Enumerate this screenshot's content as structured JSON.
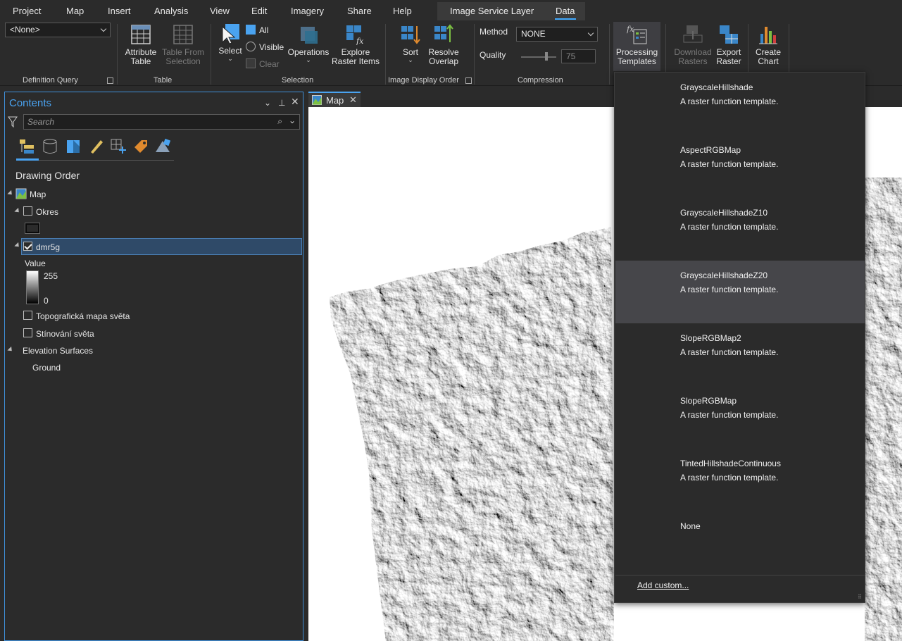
{
  "menubar": {
    "items": [
      "Project",
      "Map",
      "Insert",
      "Analysis",
      "View",
      "Edit",
      "Imagery",
      "Share",
      "Help"
    ],
    "contextual_tabs": [
      "Image Service Layer",
      "Data"
    ],
    "active_tab": "Data"
  },
  "ribbon": {
    "definition_query": {
      "value": "<None>",
      "group_label": "Definition Query"
    },
    "table": {
      "attribute_table": "Attribute\nTable",
      "table_from_selection": "Table From\nSelection",
      "group_label": "Table"
    },
    "selection": {
      "select": "Select",
      "all": "All",
      "visible": "Visible",
      "clear": "Clear",
      "operations": "Operations",
      "explore": "Explore\nRaster Items",
      "group_label": "Selection"
    },
    "image_display_order": {
      "sort": "Sort",
      "resolve_overlap": "Resolve\nOverlap",
      "group_label": "Image Display Order"
    },
    "compression": {
      "method_label": "Method",
      "method_value": "NONE",
      "quality_label": "Quality",
      "quality_value": "75",
      "group_label": "Compression"
    },
    "processing_templates": "Processing\nTemplates",
    "download_rasters": "Download\nRasters",
    "export_raster": "Export\nRaster",
    "create_chart": "Create\nChart"
  },
  "contents": {
    "title": "Contents",
    "search_placeholder": "Search",
    "section": "Drawing Order",
    "map": "Map",
    "layers": {
      "okres": "Okres",
      "dmr5g": "dmr5g",
      "legend_title": "Value",
      "legend_max": "255",
      "legend_min": "0",
      "topo": "Topografická mapa světa",
      "stinovani": "Stínování světa",
      "elevation": "Elevation Surfaces",
      "ground": "Ground"
    }
  },
  "map_tab": {
    "label": "Map"
  },
  "dropdown": {
    "items": [
      {
        "name": "GrayscaleHillshade",
        "desc": "A raster function template."
      },
      {
        "name": "AspectRGBMap",
        "desc": "A raster function template."
      },
      {
        "name": "GrayscaleHillshadeZ10",
        "desc": "A raster function template."
      },
      {
        "name": "GrayscaleHillshadeZ20",
        "desc": "A raster function template."
      },
      {
        "name": "SlopeRGBMap2",
        "desc": "A raster function template."
      },
      {
        "name": "SlopeRGBMap",
        "desc": "A raster function template."
      },
      {
        "name": "TintedHillshadeContinuous",
        "desc": "A raster function template."
      },
      {
        "name": "None",
        "desc": ""
      }
    ],
    "highlighted_index": 3,
    "add_custom": "Add custom..."
  },
  "colors": {
    "accent": "#4aa3f0",
    "background": "#2b2b2b",
    "highlight": "#46464a"
  }
}
